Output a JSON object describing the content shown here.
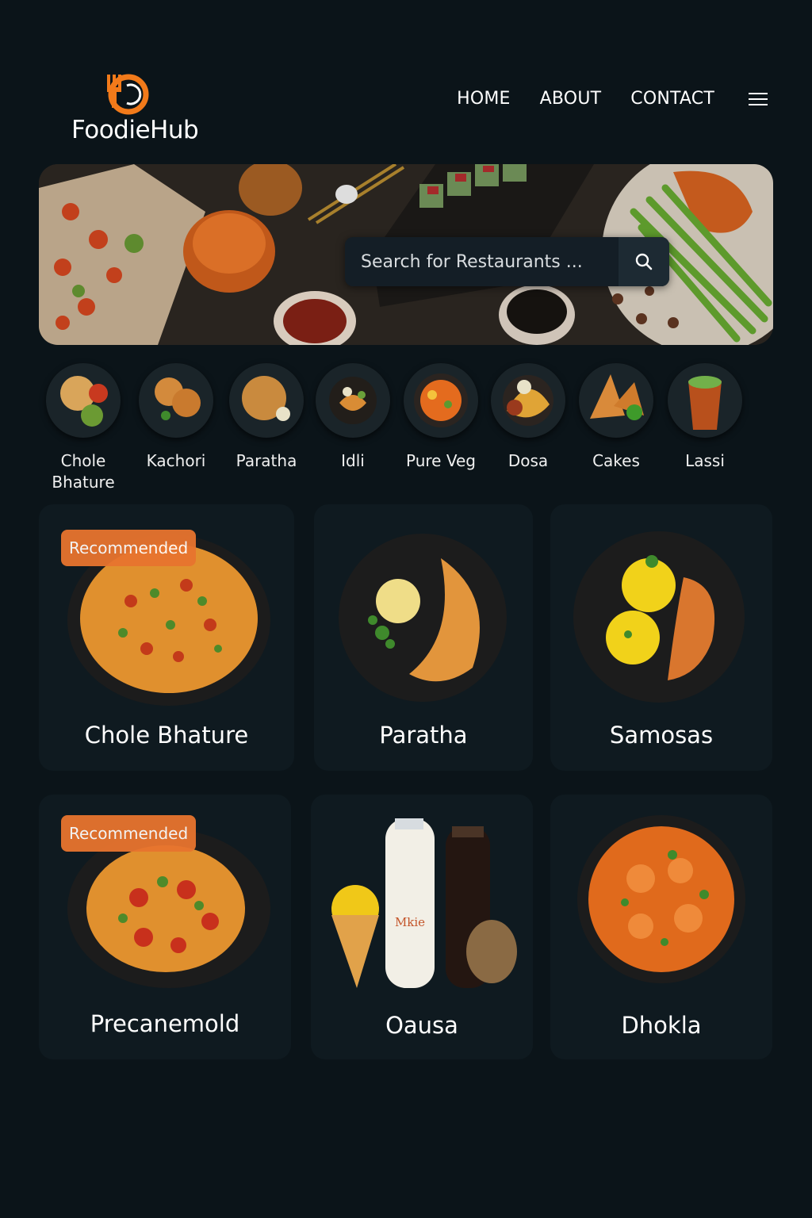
{
  "brand": {
    "name": "FoodieHub",
    "accent": "#f27a1a"
  },
  "nav": {
    "home": "HOME",
    "about": "ABOUT",
    "contact": "CONTACT",
    "menu_icon": "hamburger-icon"
  },
  "search": {
    "placeholder": "Search for Restaurants ...",
    "icon": "search-icon"
  },
  "categories": [
    {
      "label": "Chole Bhature"
    },
    {
      "label": "Kachori"
    },
    {
      "label": "Paratha"
    },
    {
      "label": "Idli"
    },
    {
      "label": "Pure Veg"
    },
    {
      "label": "Dosa"
    },
    {
      "label": "Cakes"
    },
    {
      "label": "Lassi"
    }
  ],
  "cards": [
    {
      "name": "Chole Bhature",
      "badge": "Recommended"
    },
    {
      "name": "Paratha"
    },
    {
      "name": "Samosas"
    },
    {
      "name": "Precanemold",
      "badge": "Recommended"
    },
    {
      "name": "Oausa"
    },
    {
      "name": "Dhokla"
    }
  ]
}
